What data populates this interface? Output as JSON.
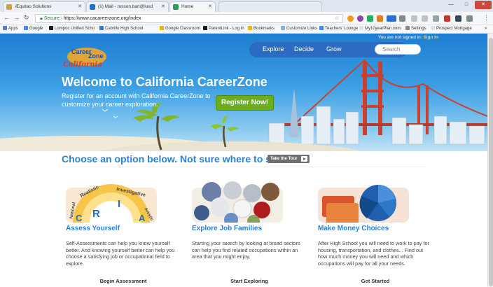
{
  "browser": {
    "tabs": [
      {
        "label": "Æquitas Solutions"
      },
      {
        "label": "(1) Mail - rosson.bari@lusd"
      },
      {
        "label": "Home"
      }
    ],
    "address": {
      "secure_label": "Secure",
      "url": "https://www.cacareerzone.org/index"
    },
    "bookmarks": [
      {
        "label": "Apps"
      },
      {
        "label": "Google"
      },
      {
        "label": "Lompoc Unified Scho"
      },
      {
        "label": "Cabrillo High School"
      },
      {
        "label": "Google Classroom"
      },
      {
        "label": "ParentLink - Log In"
      },
      {
        "label": "Bookmarks"
      },
      {
        "label": "Customize Links"
      },
      {
        "label": "Teachers' Lounge"
      },
      {
        "label": "My10yearPlan.com"
      },
      {
        "label": "Settings"
      },
      {
        "label": "Prospect Mortgage"
      }
    ]
  },
  "site": {
    "signin_text": "You are not signed in:",
    "signin_link": "Sign In",
    "nav": [
      {
        "label": "Explore"
      },
      {
        "label": "Decide"
      },
      {
        "label": "Grow"
      }
    ],
    "search_placeholder": "Search",
    "logo": {
      "line1": "Career",
      "line2": "Zone",
      "line3": "California"
    },
    "hero": {
      "title": "Welcome to California CareerZone",
      "subtitle": "Register for an account with California CareerZone to customize your career exploration.",
      "register_button": "Register Now!"
    },
    "choose": {
      "text": "Choose an option below. Not sure where to start?",
      "tour_button": "Take the Tour"
    },
    "riasec": {
      "labels": [
        "Realistic",
        "Investigative",
        "Artistic",
        "National"
      ],
      "letters": [
        "R",
        "I",
        "A",
        "C"
      ]
    },
    "columns": [
      {
        "title": "Assess Yourself",
        "description": "Self-Assessments can help you know yourself better. And knowing yourself better can help you choose a satisfying job or occupational field to explore.",
        "button": "Begin Assessment"
      },
      {
        "title": "Explore Job Families",
        "description": "Starting your search by looking at broad sectors can help you find related occupations within an area that you might enjoy.",
        "button": "Start Exploring"
      },
      {
        "title": "Make Money Choices",
        "description": "After High School you will need to work to pay for housing, transportation, and clothes... Find out how much money you will need and which occupations will pay for all your needs.",
        "button": "Get Started"
      }
    ]
  }
}
